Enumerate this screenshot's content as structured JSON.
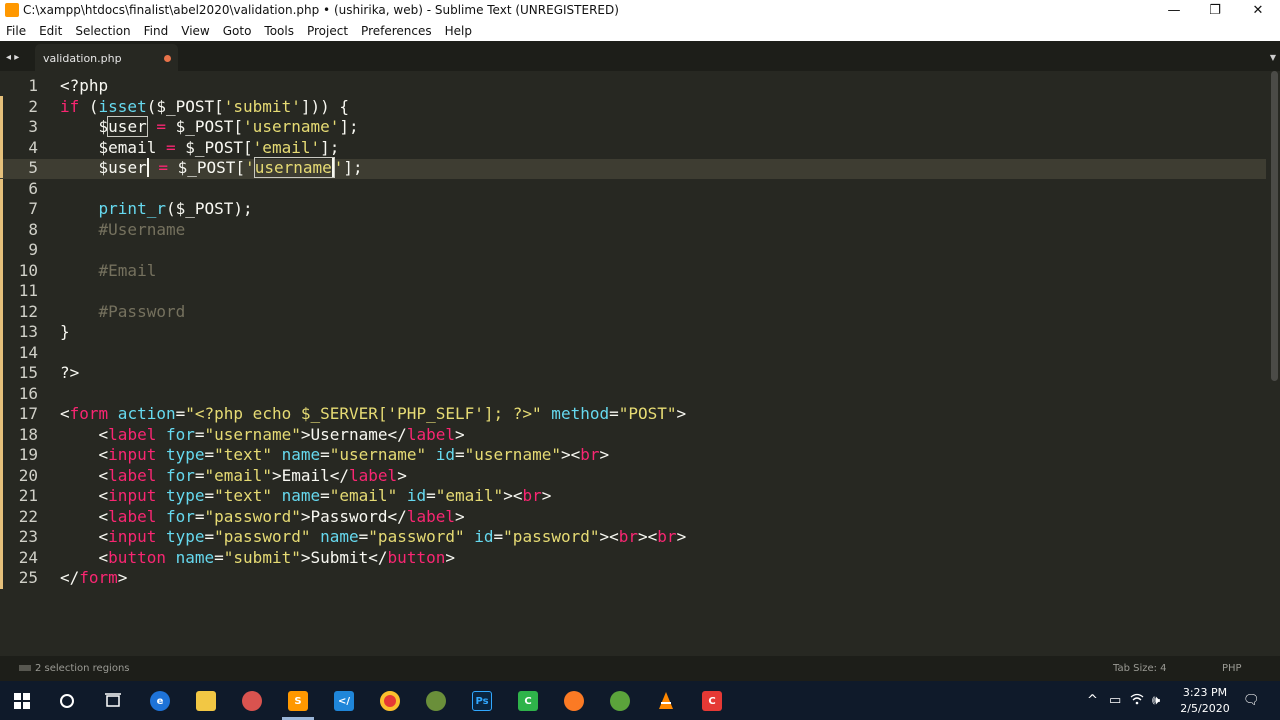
{
  "window": {
    "title": "C:\\xampp\\htdocs\\finalist\\abel2020\\validation.php • (ushirika, web) - Sublime Text (UNREGISTERED)",
    "controls": {
      "minimize": "—",
      "maximize": "❐",
      "close": "✕"
    }
  },
  "menu": [
    "File",
    "Edit",
    "Selection",
    "Find",
    "View",
    "Goto",
    "Tools",
    "Project",
    "Preferences",
    "Help"
  ],
  "tab": {
    "label": "validation.php",
    "dirty": true,
    "nav_arrows": "◂ ▸",
    "menu_glyph": "▼"
  },
  "code": {
    "line_numbers": [
      "1",
      "2",
      "3",
      "4",
      "5",
      "6",
      "7",
      "8",
      "9",
      "10",
      "11",
      "12",
      "13",
      "14",
      "15",
      "16",
      "17",
      "18",
      "19",
      "20",
      "21",
      "22",
      "23",
      "24",
      "25"
    ],
    "lines": [
      [
        {
          "t": "<?php"
        }
      ],
      [
        {
          "t": "if",
          "c": "k"
        },
        {
          "t": " ("
        },
        {
          "t": "isset",
          "c": "f"
        },
        {
          "t": "($_POST["
        },
        {
          "t": "'submit'",
          "c": "s"
        },
        {
          "t": "])) {"
        }
      ],
      [
        {
          "t": "    $"
        },
        {
          "t": "user",
          "b": true
        },
        {
          "t": " "
        },
        {
          "t": "=",
          "c": "k"
        },
        {
          "t": " $_POST["
        },
        {
          "t": "'username'",
          "c": "s"
        },
        {
          "t": "];"
        }
      ],
      [
        {
          "t": "    $email "
        },
        {
          "t": "=",
          "c": "k"
        },
        {
          "t": " $_POST["
        },
        {
          "t": "'email'",
          "c": "s"
        },
        {
          "t": "];"
        }
      ],
      [
        {
          "t": "    $"
        },
        {
          "t": "user",
          "cur": true
        },
        {
          "t": " "
        },
        {
          "t": "=",
          "c": "k"
        },
        {
          "t": " $_POST["
        },
        {
          "t": "'",
          "c": "s"
        },
        {
          "t": "username",
          "c": "s",
          "b": true,
          "cur": true
        },
        {
          "t": "'",
          "c": "s"
        },
        {
          "t": "];"
        }
      ],
      [],
      [
        {
          "t": "    "
        },
        {
          "t": "print_r",
          "c": "f"
        },
        {
          "t": "($_POST);"
        }
      ],
      [
        {
          "t": "    #Username",
          "c": "c"
        }
      ],
      [],
      [
        {
          "t": "    #Email",
          "c": "c"
        }
      ],
      [],
      [
        {
          "t": "    #Password",
          "c": "c"
        }
      ],
      [
        {
          "t": "}"
        }
      ],
      [],
      [
        {
          "t": "?>"
        }
      ],
      [],
      [
        {
          "t": "<"
        },
        {
          "t": "form",
          "c": "k"
        },
        {
          "t": " action",
          "c": "f"
        },
        {
          "t": "="
        },
        {
          "t": "\"<?php echo $_SERVER['PHP_SELF']; ?>\"",
          "c": "s"
        },
        {
          "t": " method",
          "c": "f"
        },
        {
          "t": "="
        },
        {
          "t": "\"POST\"",
          "c": "s"
        },
        {
          "t": ">"
        }
      ],
      [
        {
          "t": "    <"
        },
        {
          "t": "label",
          "c": "k"
        },
        {
          "t": " for",
          "c": "f"
        },
        {
          "t": "="
        },
        {
          "t": "\"username\"",
          "c": "s"
        },
        {
          "t": ">Username</"
        },
        {
          "t": "label",
          "c": "k"
        },
        {
          "t": ">"
        }
      ],
      [
        {
          "t": "    <"
        },
        {
          "t": "input",
          "c": "k"
        },
        {
          "t": " type",
          "c": "f"
        },
        {
          "t": "="
        },
        {
          "t": "\"text\"",
          "c": "s"
        },
        {
          "t": " name",
          "c": "f"
        },
        {
          "t": "="
        },
        {
          "t": "\"username\"",
          "c": "s"
        },
        {
          "t": " id",
          "c": "f"
        },
        {
          "t": "="
        },
        {
          "t": "\"username\"",
          "c": "s"
        },
        {
          "t": "><"
        },
        {
          "t": "br",
          "c": "k"
        },
        {
          "t": ">"
        }
      ],
      [
        {
          "t": "    <"
        },
        {
          "t": "label",
          "c": "k"
        },
        {
          "t": " for",
          "c": "f"
        },
        {
          "t": "="
        },
        {
          "t": "\"email\"",
          "c": "s"
        },
        {
          "t": ">Email</"
        },
        {
          "t": "label",
          "c": "k"
        },
        {
          "t": ">"
        }
      ],
      [
        {
          "t": "    <"
        },
        {
          "t": "input",
          "c": "k"
        },
        {
          "t": " type",
          "c": "f"
        },
        {
          "t": "="
        },
        {
          "t": "\"text\"",
          "c": "s"
        },
        {
          "t": " name",
          "c": "f"
        },
        {
          "t": "="
        },
        {
          "t": "\"email\"",
          "c": "s"
        },
        {
          "t": " id",
          "c": "f"
        },
        {
          "t": "="
        },
        {
          "t": "\"email\"",
          "c": "s"
        },
        {
          "t": "><"
        },
        {
          "t": "br",
          "c": "k"
        },
        {
          "t": ">"
        }
      ],
      [
        {
          "t": "    <"
        },
        {
          "t": "label",
          "c": "k"
        },
        {
          "t": " for",
          "c": "f"
        },
        {
          "t": "="
        },
        {
          "t": "\"password\"",
          "c": "s"
        },
        {
          "t": ">Password</"
        },
        {
          "t": "label",
          "c": "k"
        },
        {
          "t": ">"
        }
      ],
      [
        {
          "t": "    <"
        },
        {
          "t": "input",
          "c": "k"
        },
        {
          "t": " type",
          "c": "f"
        },
        {
          "t": "="
        },
        {
          "t": "\"password\"",
          "c": "s"
        },
        {
          "t": " name",
          "c": "f"
        },
        {
          "t": "="
        },
        {
          "t": "\"password\"",
          "c": "s"
        },
        {
          "t": " id",
          "c": "f"
        },
        {
          "t": "="
        },
        {
          "t": "\"password\"",
          "c": "s"
        },
        {
          "t": "><"
        },
        {
          "t": "br",
          "c": "k"
        },
        {
          "t": "><"
        },
        {
          "t": "br",
          "c": "k"
        },
        {
          "t": ">"
        }
      ],
      [
        {
          "t": "    <"
        },
        {
          "t": "button",
          "c": "k"
        },
        {
          "t": " name",
          "c": "f"
        },
        {
          "t": "="
        },
        {
          "t": "\"submit\"",
          "c": "s"
        },
        {
          "t": ">Submit</"
        },
        {
          "t": "button",
          "c": "k"
        },
        {
          "t": ">"
        }
      ],
      [
        {
          "t": "</"
        },
        {
          "t": "form",
          "c": "k"
        },
        {
          "t": ">"
        }
      ]
    ]
  },
  "status": {
    "selection": "2 selection regions",
    "tab_size": "Tab Size: 4",
    "syntax": "PHP"
  },
  "taskbar": {
    "icons": [
      "windows-start-icon",
      "search-icon",
      "task-view-icon",
      "edge-icon",
      "file-explorer-icon",
      "snipping-tool-icon",
      "sublime-text-icon",
      "vscode-icon",
      "chrome-icon",
      "gimp-icon",
      "photoshop-icon",
      "camtasia-icon",
      "xampp-icon",
      "greenshot-icon",
      "vlc-icon",
      "recorder-icon"
    ],
    "tray_glyphs": [
      "^",
      "▭",
      "🕪",
      "🗨"
    ],
    "time": "3:23 PM",
    "date": "2/5/2020"
  },
  "colors": {
    "editor_bg": "#272822",
    "keyword": "#f92672",
    "string": "#e6db74",
    "function": "#66d9ef",
    "comment": "#75715e",
    "modified_marker": "#e5c07b"
  }
}
